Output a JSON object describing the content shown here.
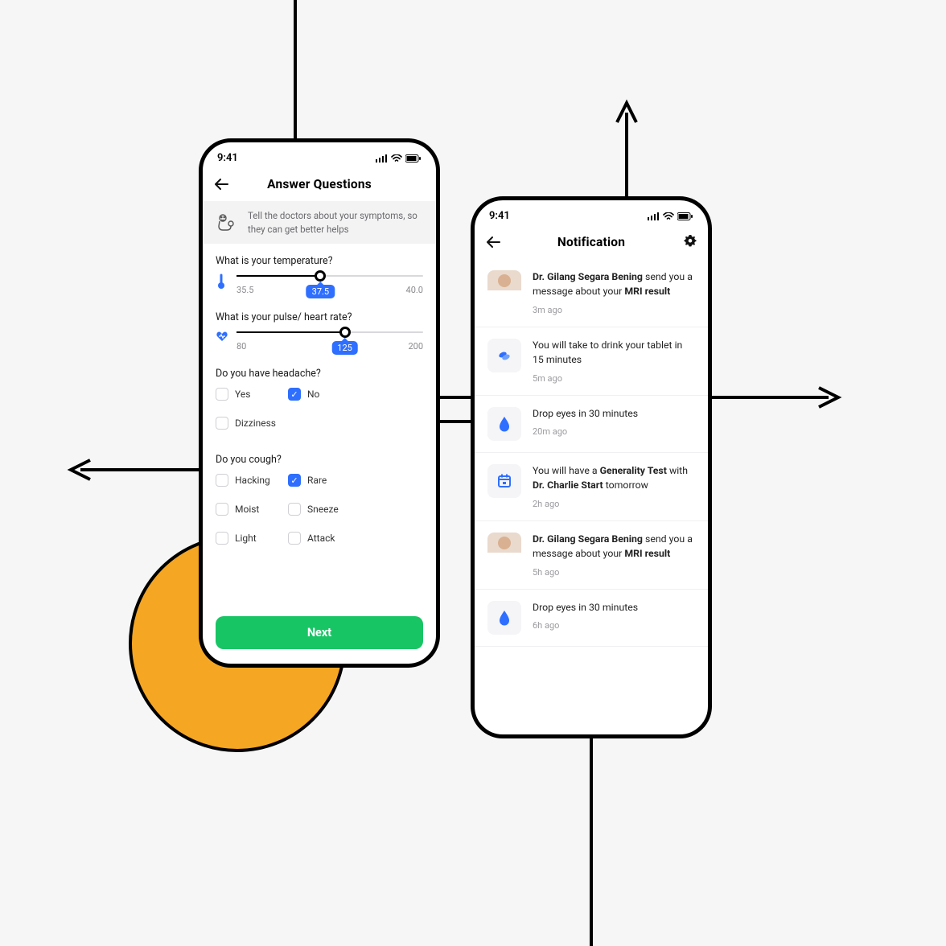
{
  "colors": {
    "accent_blue": "#2f6fff",
    "accent_green": "#18c564",
    "accent_orange": "#f5a623"
  },
  "statusbar": {
    "time": "9:41"
  },
  "left": {
    "title": "Answer Questions",
    "banner": "Tell the doctors about your symptoms, so they can get better helps",
    "q1": {
      "label": "What is your temperature?",
      "min": "35.5",
      "max": "40.0",
      "value": "37.5",
      "fill_pct": 45
    },
    "q2": {
      "label": "What is your pulse/ heart rate?",
      "min": "80",
      "max": "200",
      "value": "125",
      "fill_pct": 58
    },
    "q3": {
      "label": "Do you have headache?",
      "options": [
        {
          "label": "Yes",
          "checked": false
        },
        {
          "label": "No",
          "checked": true
        },
        {
          "label": "Dizziness",
          "checked": false
        }
      ]
    },
    "q4": {
      "label": "Do you cough?",
      "options": [
        {
          "label": "Hacking",
          "checked": false
        },
        {
          "label": "Rare",
          "checked": true
        },
        {
          "label": "Moist",
          "checked": false
        },
        {
          "label": "Sneeze",
          "checked": false
        },
        {
          "label": "Light",
          "checked": false
        },
        {
          "label": "Attack",
          "checked": false
        }
      ]
    },
    "next_label": "Next"
  },
  "right": {
    "title": "Notification",
    "items": [
      {
        "kind": "avatar",
        "text_before": "",
        "bold": "Dr. Gilang Segara Bening",
        "text_mid": " send you a message about your ",
        "bold2": "MRI result",
        "text_after": "",
        "time": "3m ago"
      },
      {
        "kind": "pill",
        "text_before": "You will take to drink your tablet in 15 minutes",
        "bold": "",
        "text_mid": "",
        "bold2": "",
        "text_after": "",
        "time": "5m ago"
      },
      {
        "kind": "drop",
        "text_before": "Drop eyes in 30 minutes",
        "bold": "",
        "text_mid": "",
        "bold2": "",
        "text_after": "",
        "time": "20m ago"
      },
      {
        "kind": "cal",
        "text_before": "You will have a ",
        "bold": "Generality Test",
        "text_mid": " with ",
        "bold2": "Dr. Charlie Start",
        "text_after": " tomorrow",
        "time": "2h ago"
      },
      {
        "kind": "avatar",
        "text_before": "",
        "bold": "Dr. Gilang Segara Bening",
        "text_mid": " send you a message about your ",
        "bold2": "MRI result",
        "text_after": "",
        "time": "5h ago"
      },
      {
        "kind": "drop",
        "text_before": "Drop eyes in 30 minutes",
        "bold": "",
        "text_mid": "",
        "bold2": "",
        "text_after": "",
        "time": "6h ago"
      }
    ]
  }
}
